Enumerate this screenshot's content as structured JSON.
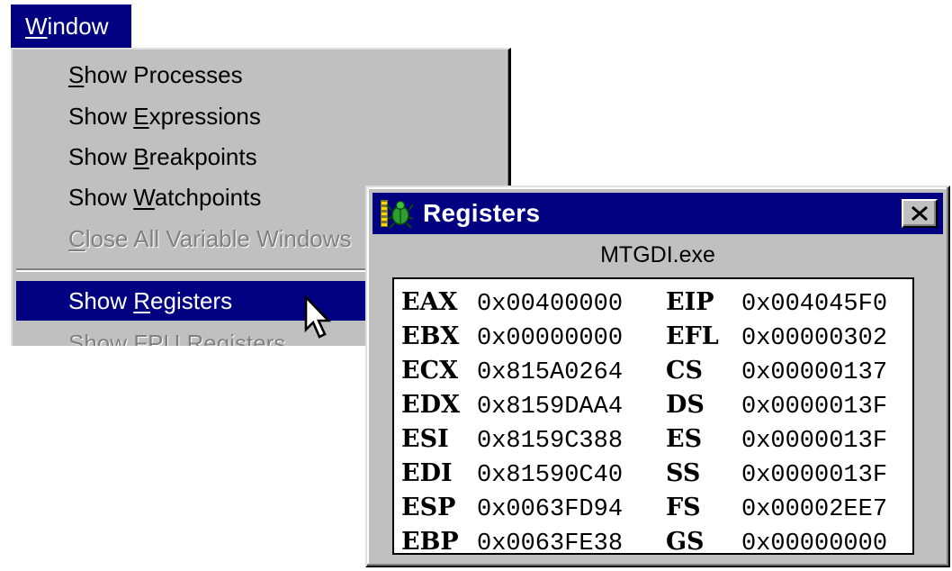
{
  "menu": {
    "title_accel": "W",
    "title_rest": "indow",
    "items": [
      {
        "pre": "",
        "accel": "S",
        "post": "how Processes",
        "state": "normal"
      },
      {
        "pre": "Show ",
        "accel": "E",
        "post": "xpressions",
        "state": "normal"
      },
      {
        "pre": "Show ",
        "accel": "B",
        "post": "reakpoints",
        "state": "normal"
      },
      {
        "pre": "Show ",
        "accel": "W",
        "post": "atchpoints",
        "state": "normal"
      },
      {
        "pre": "",
        "accel": "C",
        "post": "lose All Variable Windows",
        "state": "disabled"
      },
      {
        "pre": "Show ",
        "accel": "R",
        "post": "egisters",
        "state": "selected"
      },
      {
        "pre": "Show ",
        "accel": "F",
        "post": "PU Registers",
        "state": "disabled"
      }
    ]
  },
  "registers_window": {
    "title": "Registers",
    "exe": "MTGDI.exe",
    "rows": [
      {
        "r1": "EAX",
        "v1": "0x00400000",
        "r2": "EIP",
        "v2": "0x004045F0"
      },
      {
        "r1": "EBX",
        "v1": "0x00000000",
        "r2": "EFL",
        "v2": "0x00000302"
      },
      {
        "r1": "ECX",
        "v1": "0x815A0264",
        "r2": "CS",
        "v2": "0x00000137"
      },
      {
        "r1": "EDX",
        "v1": "0x8159DAA4",
        "r2": "DS",
        "v2": "0x0000013F"
      },
      {
        "r1": "ESI",
        "v1": "0x8159C388",
        "r2": "ES",
        "v2": "0x0000013F"
      },
      {
        "r1": "EDI",
        "v1": "0x81590C40",
        "r2": "SS",
        "v2": "0x0000013F"
      },
      {
        "r1": "ESP",
        "v1": "0x0063FD94",
        "r2": "FS",
        "v2": "0x00002EE7"
      },
      {
        "r1": "EBP",
        "v1": "0x0063FE38",
        "r2": "GS",
        "v2": "0x00000000"
      }
    ]
  },
  "colors": {
    "titlebar": "#000080",
    "face": "#c0c0c0",
    "highlight_text": "#ffffff"
  },
  "icons": {
    "app": "bug-icon",
    "close": "close-icon",
    "cursor": "mouse-pointer-icon"
  }
}
